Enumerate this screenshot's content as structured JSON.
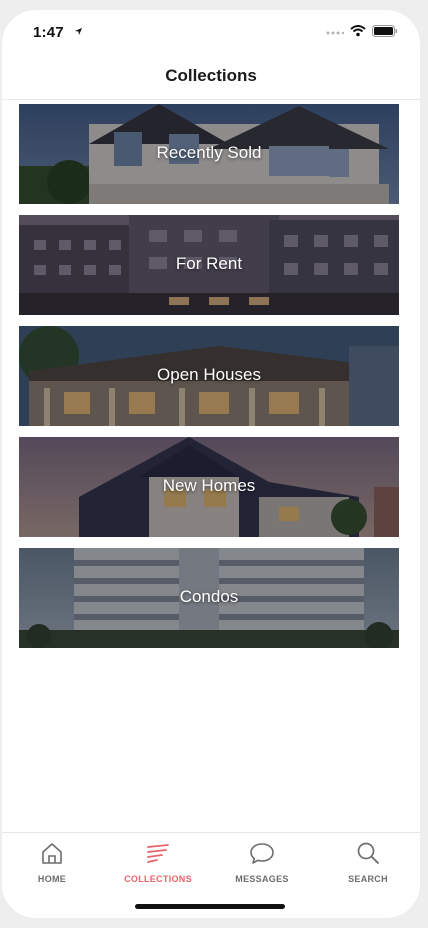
{
  "status_bar": {
    "time": "1:47",
    "icons": [
      "location-arrow-icon",
      "signal-icon",
      "wifi-icon",
      "battery-icon"
    ]
  },
  "nav": {
    "title": "Collections"
  },
  "collections": [
    {
      "label": "Recently Sold",
      "image": "suburban-house-image"
    },
    {
      "label": "For Rent",
      "image": "apartment-building-image"
    },
    {
      "label": "Open Houses",
      "image": "porch-house-image"
    },
    {
      "label": "New Homes",
      "image": "new-home-image"
    },
    {
      "label": "Condos",
      "image": "condo-tower-image"
    }
  ],
  "tabs": [
    {
      "label": "HOME",
      "icon": "home-icon",
      "active": false
    },
    {
      "label": "COLLECTIONS",
      "icon": "collections-icon",
      "active": true
    },
    {
      "label": "MESSAGES",
      "icon": "chat-bubble-icon",
      "active": false
    },
    {
      "label": "SEARCH",
      "icon": "search-icon",
      "active": false
    }
  ],
  "colors": {
    "accent": "#e8656b",
    "tab_inactive": "#6d6d6d",
    "title": "#1a1a1a"
  }
}
